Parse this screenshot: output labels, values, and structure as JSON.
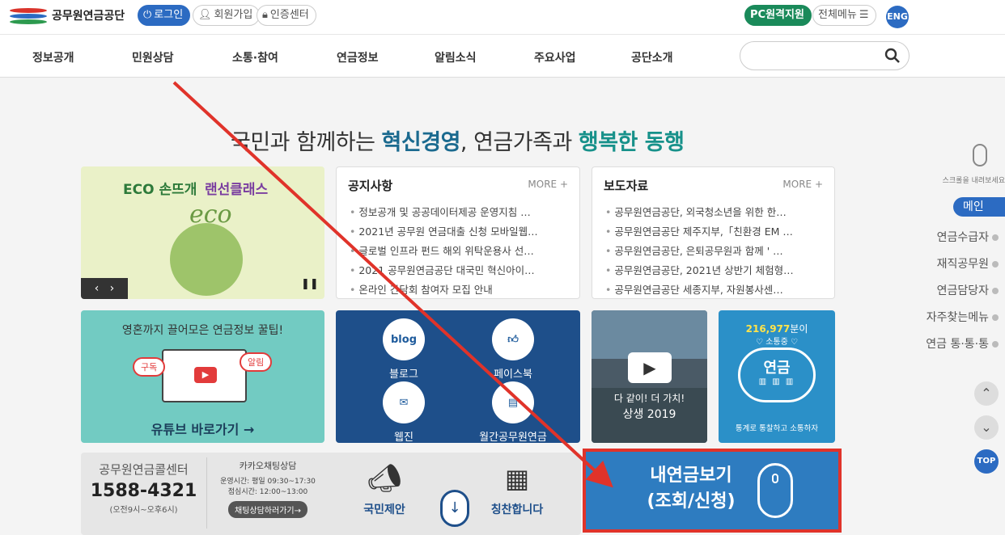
{
  "header": {
    "logo": "공무원연금공단",
    "login": "로그인",
    "signup": "회원가입",
    "cert": "인증센터",
    "pc_support": "PC원격지원",
    "all_menu": "전체메뉴",
    "eng": "ENG"
  },
  "nav": [
    "정보공개",
    "민원상담",
    "소통·참여",
    "연금정보",
    "알림소식",
    "주요사업",
    "공단소개"
  ],
  "hero": {
    "p1": "국민과 함께하는 ",
    "p2": "혁신경영",
    "p3": ", 연금가족과 ",
    "p4": "행복한 동행"
  },
  "banner": {
    "title_a": "ECO 손뜨개",
    "title_b": "랜선클래스",
    "script": "eco"
  },
  "notice": {
    "title": "공지사항",
    "more": "MORE +",
    "items": [
      "정보공개 및 공공데이터제공 운영지침 …",
      "2021년 공무원 연금대출 신청 모바일웹…",
      "글로벌 인프라 펀드 해외 위탁운용사 선…",
      "2021 공무원연금공단 대국민 혁신아이…",
      "온라인 간담회 참여자 모집 안내"
    ]
  },
  "press": {
    "title": "보도자료",
    "more": "MORE +",
    "items": [
      "공무원연금공단, 외국청소년을 위한 한…",
      "공무원연금공단 제주지부,「친환경 EM …",
      "공무원연금공단, 은퇴공무원과 함께 ' …",
      "공무원연금공단, 2021년 상반기 체험형…",
      "공무원연금공단 세종지부, 자원봉사센…"
    ]
  },
  "youtube": {
    "top": "영혼까지 끌어모은 연금정보 꿀팁!",
    "sub": "구독",
    "alarm": "알림",
    "link": "유튜브 바로가기 →"
  },
  "sns": {
    "blog_icon": "blog",
    "blog": "블로그",
    "facebook": "페이스북",
    "webzine": "웹진",
    "monthly": "월간공무원연금"
  },
  "video": {
    "line1": "다 같이! 더 가치!",
    "line2": "상생 2019"
  },
  "cloud": {
    "count": "216,977",
    "count_suffix": "분이",
    "sub": "♡ 소통중 ♡",
    "label": "연금",
    "bottom": "통계로 통찰하고 소통하자"
  },
  "callcenter": {
    "title": "공무원연금콜센터",
    "phone": "1588-4321",
    "hours": "(오전9시~오후6시)"
  },
  "kakao": {
    "title": "카카오채팅상담",
    "hours1": "운영시간: 평일 09:30~17:30",
    "hours2": "점심시간: 12:00~13:00",
    "button": "채팅상담하러가기→"
  },
  "proposal": "국민제안",
  "praise": "칭찬합니다",
  "my_pension": {
    "line1": "내연금보기",
    "line2": "(조회/신청)"
  },
  "sidebar": {
    "scroll_hint": "스크롤을 내려보세요",
    "items": [
      "메인",
      "연금수급자",
      "재직공무원",
      "연금담당자",
      "자주찾는메뉴",
      "연금 통·통·통"
    ],
    "top": "TOP"
  },
  "colors": {
    "accent_blue": "#2c6bc2",
    "teal": "#17918a",
    "annotation_red": "#e0332a",
    "pension_blue": "#2e7cc0"
  }
}
